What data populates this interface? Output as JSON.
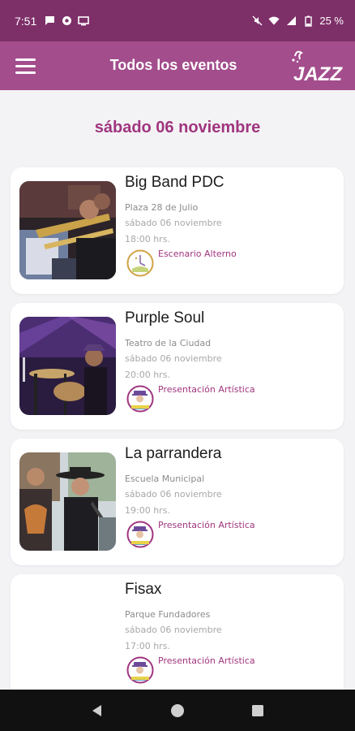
{
  "status_bar": {
    "time": "7:51",
    "battery": "25 %"
  },
  "app_bar": {
    "title": "Todos los eventos",
    "logo_text": "JAZZ"
  },
  "date_header": "sábado 06 noviembre",
  "events": [
    {
      "title": "Big Band PDC",
      "venue": "Plaza 28 de Julio",
      "date": "sábado 06 noviembre",
      "time": "18:00 hrs.",
      "type": "Escenario Alterno",
      "type_icon": "clock-stage-icon"
    },
    {
      "title": "Purple Soul",
      "venue": "Teatro de la Ciudad",
      "date": "sábado 06 noviembre",
      "time": "20:00 hrs.",
      "type": "Presentación Artística",
      "type_icon": "performer-icon"
    },
    {
      "title": "La parrandera",
      "venue": "Escuela Municipal",
      "date": "sábado 06 noviembre",
      "time": "19:00 hrs.",
      "type": "Presentación Artística",
      "type_icon": "performer-icon"
    },
    {
      "title": "Fisax",
      "venue": "Parque Fundadores",
      "date": "sábado 06 noviembre",
      "time": "17:00 hrs.",
      "type": "Presentación Artística",
      "type_icon": "performer-icon"
    }
  ],
  "colors": {
    "status_bar": "#7d2f68",
    "app_bar": "#a34d8c",
    "accent": "#a0357e",
    "background": "#f3f3f6"
  }
}
